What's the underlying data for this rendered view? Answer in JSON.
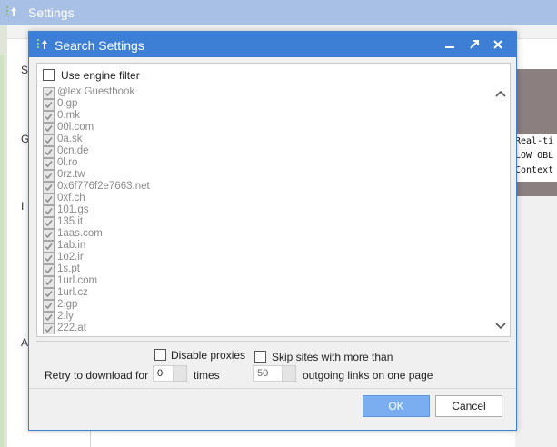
{
  "background_window": {
    "title": "Settings",
    "left_letters": [
      "S",
      "G",
      "I",
      "A"
    ],
    "right_text_lines": [
      "Real-ti",
      "LOW OBL",
      "Context"
    ]
  },
  "dialog": {
    "title": "Search Settings",
    "use_engine_filter_label": "Use engine filter",
    "engines": [
      "@lex Guestbook",
      "0.gp",
      "0.mk",
      "00l.com",
      "0a.sk",
      "0cn.de",
      "0l.ro",
      "0rz.tw",
      "0x6f776f2e7663.net",
      "0xf.ch",
      "101.gs",
      "135.it",
      "1aas.com",
      "1ab.in",
      "1o2.ir",
      "1s.pt",
      "1url.com",
      "1url.cz",
      "2.gp",
      "2.ly",
      "222.at"
    ],
    "disable_proxies_label": "Disable proxies",
    "skip_sites_label": "Skip sites with more than",
    "retry_label": "Retry to download for",
    "retry_value": "0",
    "times_label": "times",
    "links_value": "50",
    "links_label": "outgoing links on one page",
    "ok_label": "OK",
    "cancel_label": "Cancel"
  },
  "colors": {
    "titlebar_active": "#3c7fd4",
    "titlebar_inactive": "#a8c0e4",
    "ok_button": "#7aaef0"
  }
}
